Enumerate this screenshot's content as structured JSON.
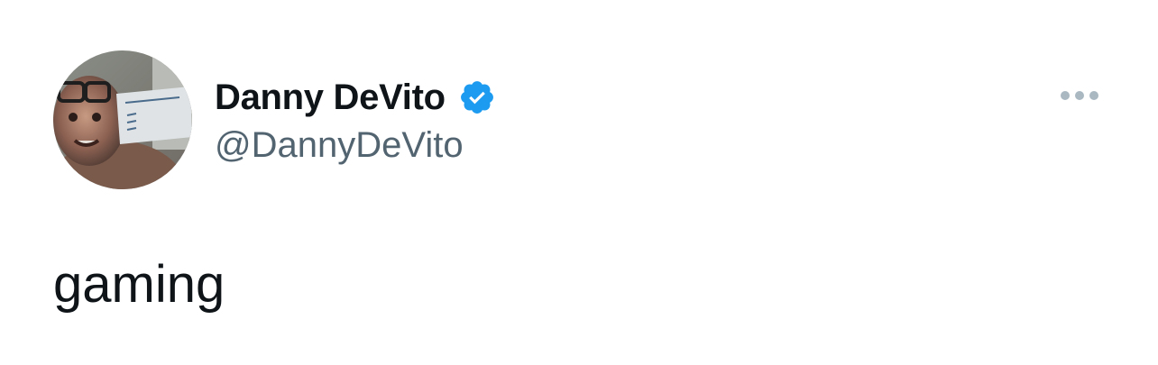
{
  "tweet": {
    "author": {
      "display_name": "Danny DeVito",
      "handle": "@DannyDeVito",
      "verified": true,
      "avatar_icon": "profile-photo"
    },
    "text": "gaming",
    "more_icon": "more-dots-icon"
  },
  "colors": {
    "text_primary": "#0f1419",
    "text_secondary": "#536471",
    "verified_blue": "#1d9bf0",
    "icon_grey": "#aab8c2",
    "background": "#ffffff"
  }
}
